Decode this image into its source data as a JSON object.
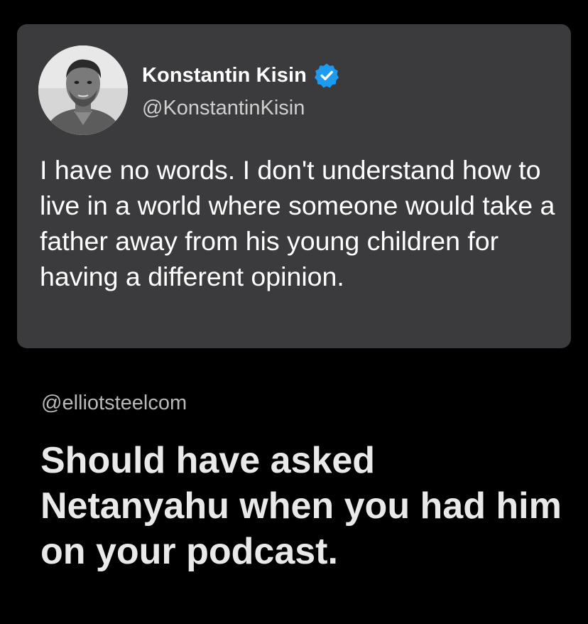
{
  "tweet": {
    "author_name": "Konstantin Kisin",
    "author_handle": "@KonstantinKisin",
    "verified": true,
    "text": "I have no words. I don't understand how to live in a world where someone would take a father away from his young children for having a different opinion.",
    "card_color": "#3b3b3d",
    "verified_badge_color": "#1d9bf0"
  },
  "reply": {
    "handle": "@elliotsteelcom",
    "text": "Should have asked Netanyahu when you had him on your podcast."
  },
  "icons": {
    "avatar": "profile-photo",
    "verified": "verified-check-icon"
  }
}
